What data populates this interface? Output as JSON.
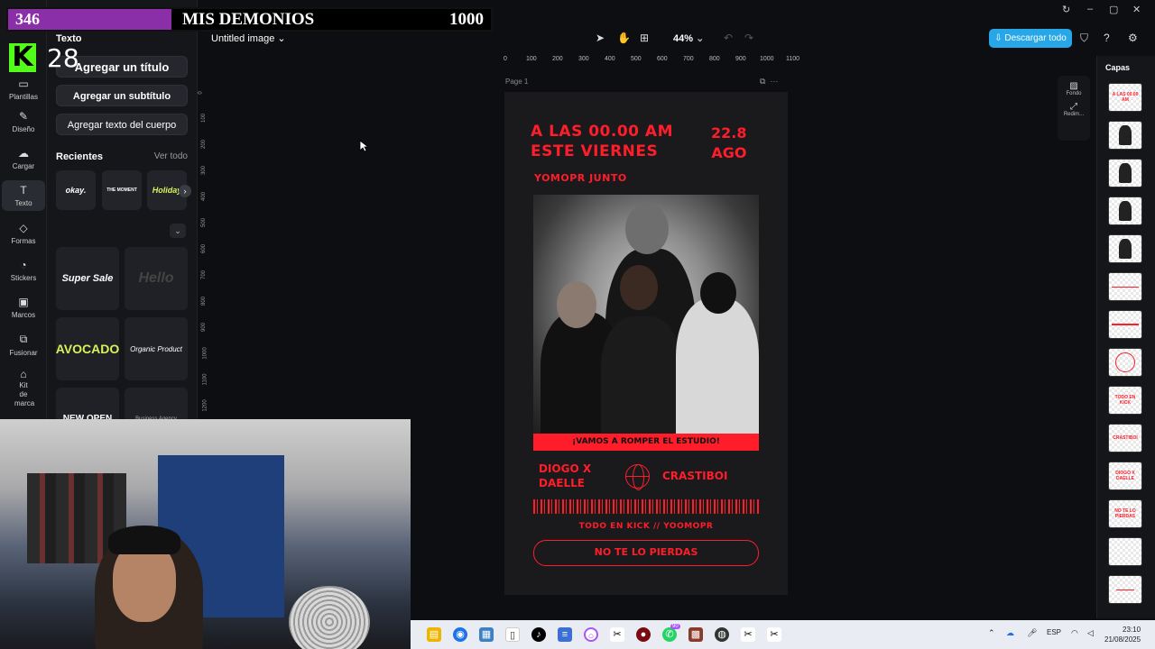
{
  "overlay": {
    "left_count": "346",
    "title": "MIS DEMONIOS",
    "right_count": "1000",
    "kick_logo": "K",
    "kick_viewers": "28"
  },
  "rail": {
    "items": [
      {
        "label": "Plantillas",
        "icon": "templates-icon"
      },
      {
        "label": "Diseño",
        "icon": "design-icon"
      },
      {
        "label": "Cargar",
        "icon": "upload-icon"
      },
      {
        "label": "Texto",
        "icon": "text-icon"
      },
      {
        "label": "Formas",
        "icon": "shapes-icon"
      },
      {
        "label": "Stickers",
        "icon": "stickers-icon"
      },
      {
        "label": "Marcos",
        "icon": "frames-icon"
      },
      {
        "label": "Fusionar",
        "icon": "merge-icon"
      },
      {
        "label": "Kit de marca",
        "icon": "brand-kit-icon"
      }
    ]
  },
  "panel": {
    "title": "Texto",
    "add_title": "Agregar un título",
    "add_subtitle": "Agregar un subtítulo",
    "add_body": "Agregar texto del cuerpo",
    "recent_label": "Recientes",
    "see_all": "Ver todo",
    "recent": [
      "okay.",
      "THE MOMENT",
      "Holiday"
    ],
    "templates": [
      "Super Sale",
      "Hello",
      "AVOCADO",
      "Organic Product",
      "NEW OPEN",
      "Business Agency"
    ]
  },
  "topbar": {
    "doc_title": "Untitled image",
    "zoom": "44%",
    "download": "Descargar todo"
  },
  "canvas": {
    "page_label": "Page 1",
    "ruler_top": [
      "0",
      "100",
      "200",
      "300",
      "400",
      "500",
      "600",
      "700",
      "800",
      "900",
      "1000",
      "1100"
    ],
    "ruler_left": [
      "0",
      "100",
      "200",
      "300",
      "400",
      "500",
      "600",
      "700",
      "800",
      "900",
      "1000",
      "1100",
      "1200"
    ]
  },
  "poster": {
    "head_line1": "A LAS 00.00 AM",
    "head_line2": "ESTE VIERNES",
    "date_line1": "22.8",
    "date_line2": "AGO",
    "sub": "YOMOPR JUNTO",
    "banner": "¡VAMOS A ROMPER EL ESTUDIO!",
    "name_left_1": "DIOGO X",
    "name_left_2": "DAELLE",
    "name_right": "CRASTIBOI",
    "footer": "TODO EN KICK // YOOMOPR",
    "cta": "NO TE LO PIERDAS",
    "accent": "#ff1d2a"
  },
  "mini_tools": {
    "background": "Fondo",
    "resize": "Redim..."
  },
  "layers": {
    "title": "Capas",
    "thumbs": [
      "A LAS 00.00 AM",
      "",
      "",
      "",
      "",
      "",
      "",
      "",
      "TODO EN KICK",
      "CRASTIBOI",
      "DIOGO X DAELLE",
      "NO TE LO PIERDAS",
      ""
    ]
  },
  "taskbar": {
    "lang": "ESP",
    "time": "23:10",
    "date": "21/08/2025",
    "badge": "90"
  }
}
